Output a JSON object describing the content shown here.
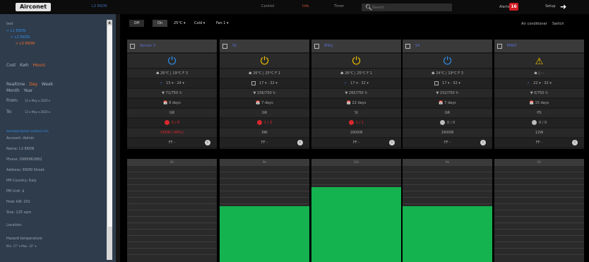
{
  "topbar": {
    "logo": "Airconet",
    "logo_sub": "",
    "breadcrumb": "L3 EKON",
    "nav": [
      "Control",
      "Info",
      "Timer"
    ],
    "active_nav": "Info",
    "search_placeholder": "Search",
    "alerts_label": "Alerts",
    "alerts_count": "16",
    "setup_label": "Setup"
  },
  "sidebar": {
    "tree": [
      "test",
      "> L1 EKON",
      "> L2 EKON",
      "> L3 EKON"
    ],
    "cost_label": "Cost",
    "kwh_label": "Kwh",
    "hours_label": "Hours",
    "realtime_label": "Realtime",
    "day_label": "Day",
    "week_label": "Week",
    "month_label": "Month",
    "year_label": "Year",
    "from_label": "From:",
    "to_label": "To:",
    "from_date": "12 ▾  May ▾  2020 ▾",
    "to_date": "13 ▾  May ▾  2020 ▾",
    "email": "developer@ekon.outlook.com",
    "account": "Account: Admin",
    "name": "Name: L3 EKON",
    "phone": "Phone: 0989962862",
    "address": "Address: EKON Street",
    "pm_country": "PM Country: Italy",
    "pm_unit": "PM Unit: $",
    "peak_kw": "Peak kW: 201",
    "size": "Size: 125 sqm",
    "location": "Location:",
    "hazard": "Hazard temperature",
    "hazard_range": "Min. 17° ▾     Max. 32° ▾"
  },
  "toolbar": {
    "off": "Off",
    "on": "On",
    "temp": "25°C ▾",
    "mode": "Cold ▾",
    "fan": "Fan 1 ▾",
    "type_label": "Air conditioner",
    "switch_label": "Switch"
  },
  "cards": [
    {
      "name": "Sensor 3",
      "power": "blue",
      "temps": "☗ 26°C  |  19°C F 3",
      "setpoint": "15 ▾   ·  24 ▾",
      "checked": true,
      "hours": "▼ 71/750  ↻",
      "days": "📅 8 days",
      "mode": "GR",
      "alarm": "5 / 8",
      "alarm_red": true,
      "power_val": "555W ( 80%)",
      "power_val_red": true,
      "ff": "FF  -"
    },
    {
      "name": "S1",
      "power": "yellow",
      "temps": "☗ 26°C  |  25°C F 1",
      "setpoint": "17 ▾   ·  32 ▾",
      "checked": false,
      "hours": "▼ 156/750  ↻",
      "days": "📅 7 days",
      "mode": "GR",
      "alarm": "1 / 3",
      "alarm_red": true,
      "power_val": "0W",
      "power_val_red": false,
      "ff": "FF  -"
    },
    {
      "name": "Milky",
      "power": "yellow",
      "temps": "☗ 26°C  |  25°C F 1",
      "setpoint": "17 ▾   ·  32 ▾",
      "checked": true,
      "hours": "▼ 265/750  ↻",
      "days": "📅 22 days",
      "mode": "SI",
      "alarm": "1 / 1",
      "alarm_red": true,
      "power_val": "1600W",
      "power_val_red": false,
      "ff": "FF  -"
    },
    {
      "name": "S4",
      "power": "blue",
      "temps": "☗ 24°C  |  19°C F 3",
      "setpoint": "17 ▾   ·  32 ▾",
      "checked": false,
      "hours": "▼ 152/750  ↻",
      "days": "📅 7 days",
      "mode": "GR",
      "alarm": "0 / 0",
      "alarm_red": false,
      "power_val": "1600W",
      "power_val_red": false,
      "ff": "FF  -"
    },
    {
      "name": "Milkfi",
      "power": "warn",
      "temps": "☗  |  - -",
      "setpoint": "22 ▾   ·  32 ▾",
      "checked": true,
      "hours": "▼ 0/750  ↻",
      "days": "📅 15 days",
      "mode": "PS",
      "alarm": "0 / 0",
      "alarm_red": false,
      "power_val": "12W",
      "power_val_red": false,
      "ff": "FF  -"
    }
  ],
  "bars": [
    {
      "label": "0h",
      "fraction": 0.0
    },
    {
      "label": "9h",
      "fraction": 0.58
    },
    {
      "label": "12h",
      "fraction": 0.78
    },
    {
      "label": "9h",
      "fraction": 0.58
    },
    {
      "label": "0h",
      "fraction": 0.0
    }
  ]
}
